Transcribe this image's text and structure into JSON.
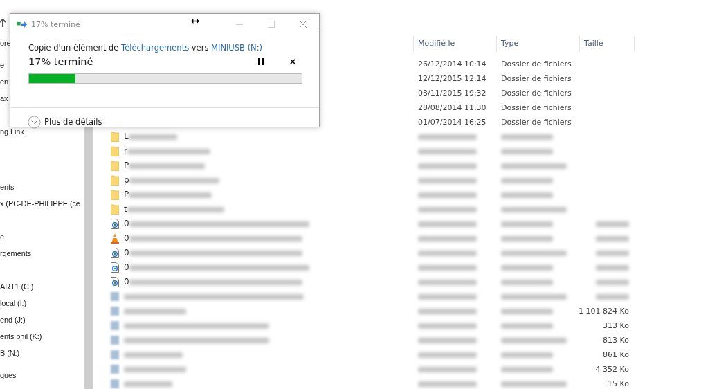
{
  "navigation": {
    "sections": [
      {
        "items": [
          "ore"
        ]
      },
      {
        "items": [
          "e",
          "en",
          "ax"
        ]
      },
      {
        "items": [
          "ng Link"
        ]
      },
      {
        "items": [
          "ents",
          "x (PC-DE-PHILIPPE (ce"
        ]
      },
      {
        "items": [
          "e",
          "rgements"
        ]
      },
      {
        "items": [
          "ART1 (C:)",
          "local (I:)",
          "end (J:)",
          "ents phil (K:)",
          "B (N:)"
        ]
      },
      {
        "items": [
          "ques"
        ]
      }
    ]
  },
  "file_list": {
    "columns": [
      "Modifié le",
      "Type",
      "Taille"
    ],
    "rows": [
      {
        "date": "26/12/2014 10:14",
        "type": "Dossier de fichiers"
      },
      {
        "date": "12/12/2015 12:14",
        "type": "Dossier de fichiers"
      },
      {
        "date": "03/11/2015 19:32",
        "type": "Dossier de fichiers"
      },
      {
        "date": "28/08/2014 11:30",
        "type": "Dossier de fichiers"
      },
      {
        "date": "01/07/2014 16:25",
        "type": "Dossier de fichiers"
      },
      {
        "kind": "folder",
        "initial": "L"
      },
      {
        "kind": "folder",
        "initial": "r"
      },
      {
        "kind": "folder",
        "initial": "P"
      },
      {
        "kind": "folder",
        "initial": "p"
      },
      {
        "kind": "folder",
        "initial": "P"
      },
      {
        "kind": "folder",
        "initial": "t"
      },
      {
        "kind": "media",
        "initial": "0"
      },
      {
        "kind": "cone",
        "initial": "0"
      },
      {
        "kind": "media",
        "initial": "0"
      },
      {
        "kind": "media",
        "initial": "0"
      },
      {
        "kind": "media",
        "initial": "0"
      },
      {
        "kind": "blurred"
      },
      {
        "kind": "blurred",
        "size": "1 101 824 Ko"
      },
      {
        "kind": "blurred",
        "size": "313 Ko"
      },
      {
        "kind": "blurred",
        "size": "813 Ko"
      },
      {
        "kind": "blurred",
        "size": "861 Ko"
      },
      {
        "kind": "blurred",
        "size": "4 352 Ko"
      },
      {
        "kind": "blurred",
        "size": "15 Ko"
      }
    ]
  },
  "copy_dialog": {
    "title": "17% terminé",
    "message": {
      "before": "Copie d'un élément de",
      "source": "Téléchargements",
      "middle": "vers",
      "destination": "MINIUSB (N:)"
    },
    "status": "17% terminé",
    "progress": {
      "level": 0.17
    },
    "details_label": "Plus de détails"
  }
}
